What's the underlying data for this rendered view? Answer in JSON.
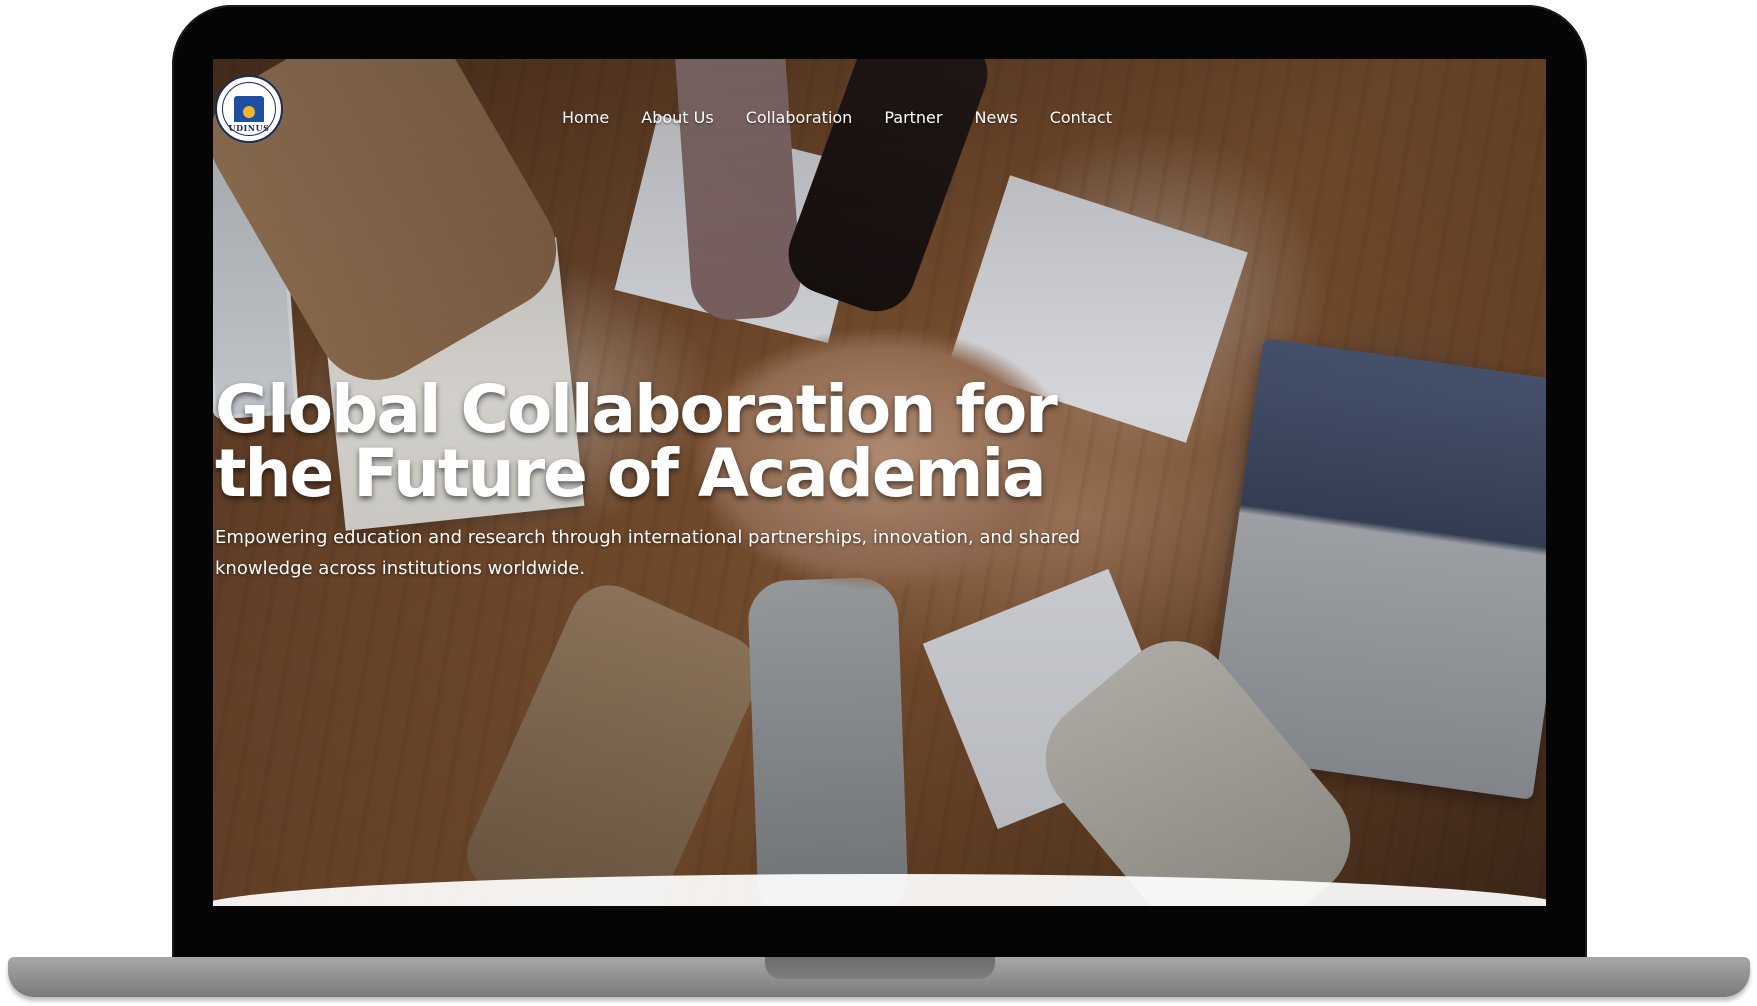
{
  "logo": {
    "text": "UDINUS",
    "ring_text": "UNIVERSITAS DIAN NUSWANTORO"
  },
  "nav": {
    "items": [
      {
        "label": "Home"
      },
      {
        "label": "About Us"
      },
      {
        "label": "Collaboration"
      },
      {
        "label": "Partner"
      },
      {
        "label": "News"
      },
      {
        "label": "Contact"
      }
    ]
  },
  "hero": {
    "title": "Global Collaboration for the Future of Academia",
    "subtitle": "Empowering education and research through international partnerships, innovation, and shared knowledge across institutions worldwide."
  },
  "colors": {
    "nav_text": "#ffffff",
    "logo_primary": "#1d2a5e",
    "logo_accent": "#f1b62b",
    "logo_blue": "#1f4fa3"
  },
  "icons": {
    "logo": "university-seal-icon"
  }
}
